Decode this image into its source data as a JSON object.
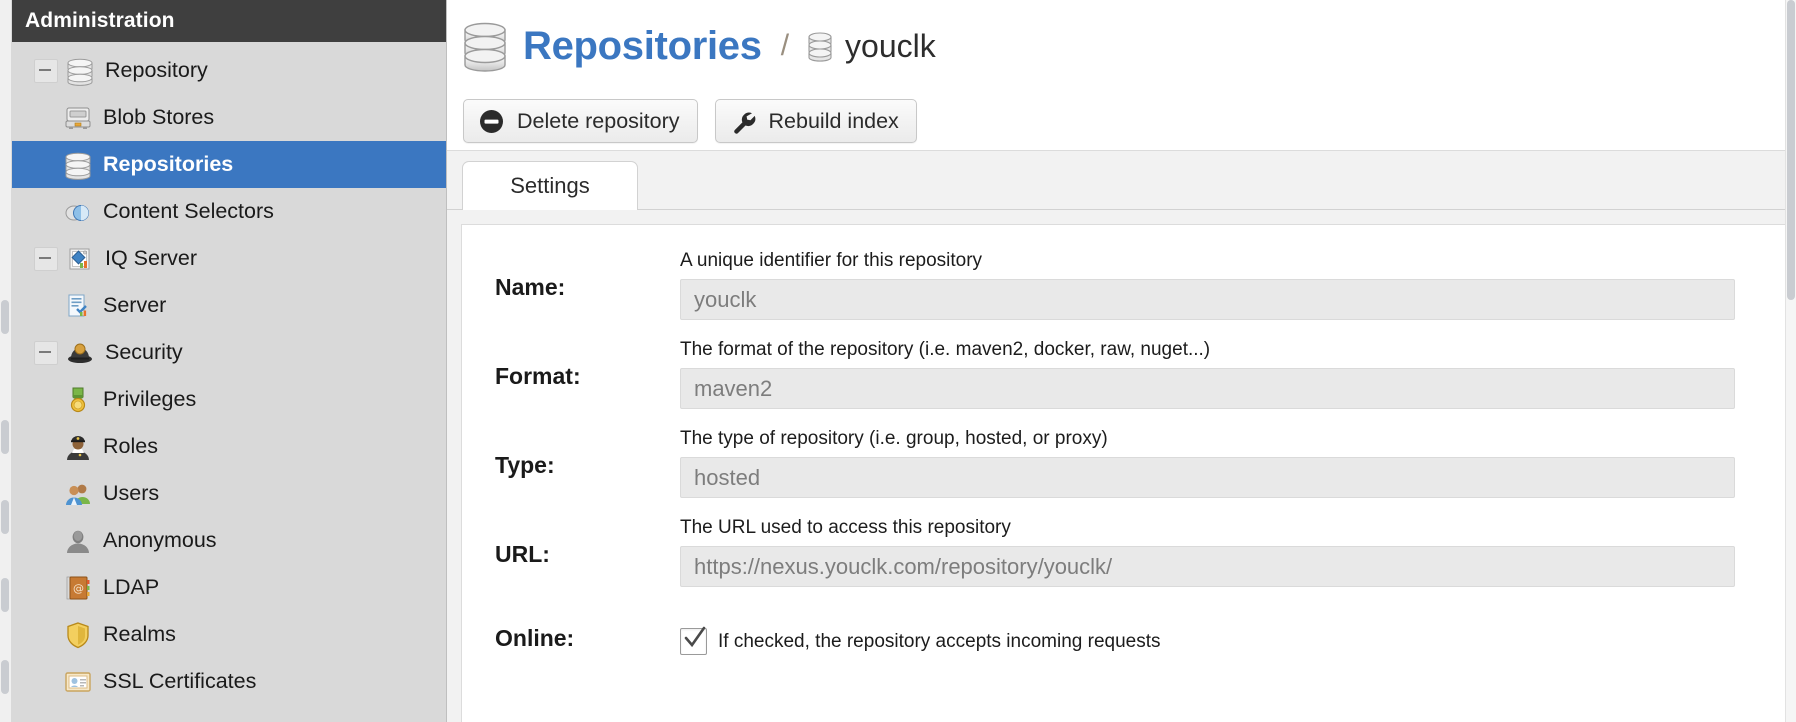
{
  "sidebar": {
    "header_title": "Administration",
    "items": [
      {
        "label": "Repository",
        "icon": "database-icon",
        "level": 0,
        "expander": true,
        "selected": false
      },
      {
        "label": "Blob Stores",
        "icon": "blob-store-icon",
        "level": 1,
        "expander": false,
        "selected": false
      },
      {
        "label": "Repositories",
        "icon": "database-icon",
        "level": 1,
        "expander": false,
        "selected": true
      },
      {
        "label": "Content Selectors",
        "icon": "content-selector-icon",
        "level": 1,
        "expander": false,
        "selected": false
      },
      {
        "label": "IQ Server",
        "icon": "iq-server-icon",
        "level": 0,
        "expander": true,
        "selected": false
      },
      {
        "label": "Server",
        "icon": "server-icon",
        "level": 1,
        "expander": false,
        "selected": false
      },
      {
        "label": "Security",
        "icon": "security-guard-icon",
        "level": 0,
        "expander": true,
        "selected": false
      },
      {
        "label": "Privileges",
        "icon": "medal-icon",
        "level": 1,
        "expander": false,
        "selected": false
      },
      {
        "label": "Roles",
        "icon": "police-officer-icon",
        "level": 1,
        "expander": false,
        "selected": false
      },
      {
        "label": "Users",
        "icon": "users-icon",
        "level": 1,
        "expander": false,
        "selected": false
      },
      {
        "label": "Anonymous",
        "icon": "anonymous-user-icon",
        "level": 1,
        "expander": false,
        "selected": false
      },
      {
        "label": "LDAP",
        "icon": "address-book-icon",
        "level": 1,
        "expander": false,
        "selected": false
      },
      {
        "label": "Realms",
        "icon": "shield-icon",
        "level": 1,
        "expander": false,
        "selected": false
      },
      {
        "label": "SSL Certificates",
        "icon": "certificate-icon",
        "level": 1,
        "expander": false,
        "selected": false
      }
    ]
  },
  "header": {
    "title": "Repositories",
    "separator": "/",
    "breadcrumb": "youclk",
    "title_icon": "database-icon",
    "breadcrumb_icon": "database-icon"
  },
  "toolbar": {
    "buttons": [
      {
        "label": "Delete repository",
        "icon": "delete-circle-icon"
      },
      {
        "label": "Rebuild index",
        "icon": "wrench-icon"
      }
    ]
  },
  "tabs": [
    {
      "label": "Settings",
      "active": true
    }
  ],
  "form": {
    "fields": [
      {
        "label": "Name:",
        "help": "A unique identifier for this repository",
        "value": "youclk"
      },
      {
        "label": "Format:",
        "help": "The format of the repository (i.e. maven2, docker, raw, nuget...)",
        "value": "maven2"
      },
      {
        "label": "Type:",
        "help": "The type of repository (i.e. group, hosted, or proxy)",
        "value": "hosted"
      },
      {
        "label": "URL:",
        "help": "The URL used to access this repository",
        "value": "https://nexus.youclk.com/repository/youclk/"
      }
    ],
    "online": {
      "label": "Online:",
      "help": "If checked, the repository accepts incoming requests",
      "checked": true
    }
  },
  "colors": {
    "accent_blue": "#3b77c1",
    "sidebar_bg": "#d9d9d9",
    "sidebar_header_bg": "#3f3f3f",
    "input_bg": "#e9e9e9"
  }
}
